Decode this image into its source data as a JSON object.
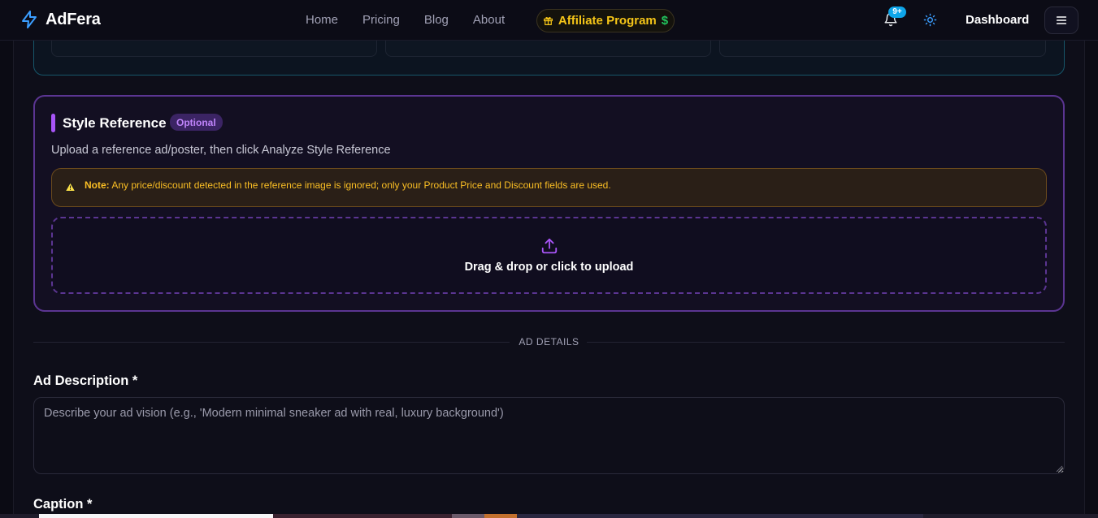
{
  "header": {
    "brand": "AdFera",
    "nav": [
      "Home",
      "Pricing",
      "Blog",
      "About"
    ],
    "affiliate_label": "Affiliate Program",
    "affiliate_suffix": "$",
    "notification_badge": "9+",
    "dashboard_label": "Dashboard",
    "accent_color": "#3b9eff"
  },
  "style_reference": {
    "title": "Style Reference",
    "badge": "Optional",
    "subtitle": "Upload a reference ad/poster, then click Analyze Style Reference",
    "note_label": "Note:",
    "note_text": "Any price/discount detected in the reference image is ignored; only your Product Price and Discount fields are used.",
    "upload_text": "Drag & drop or click to upload",
    "accent_color": "#a855f7"
  },
  "ad_details": {
    "section_label": "AD DETAILS",
    "description_label": "Ad Description *",
    "description_placeholder": "Describe your ad vision (e.g., 'Modern minimal sneaker ad with real, luxury background')",
    "description_value": "",
    "caption_label": "Caption *"
  },
  "icons": {
    "brand": "lightning-bolt-icon",
    "affiliate": "gift-icon",
    "notifications": "bell-icon",
    "theme": "sun-icon",
    "menu": "hamburger-menu-icon",
    "note": "warning-triangle-icon",
    "upload": "upload-icon"
  }
}
